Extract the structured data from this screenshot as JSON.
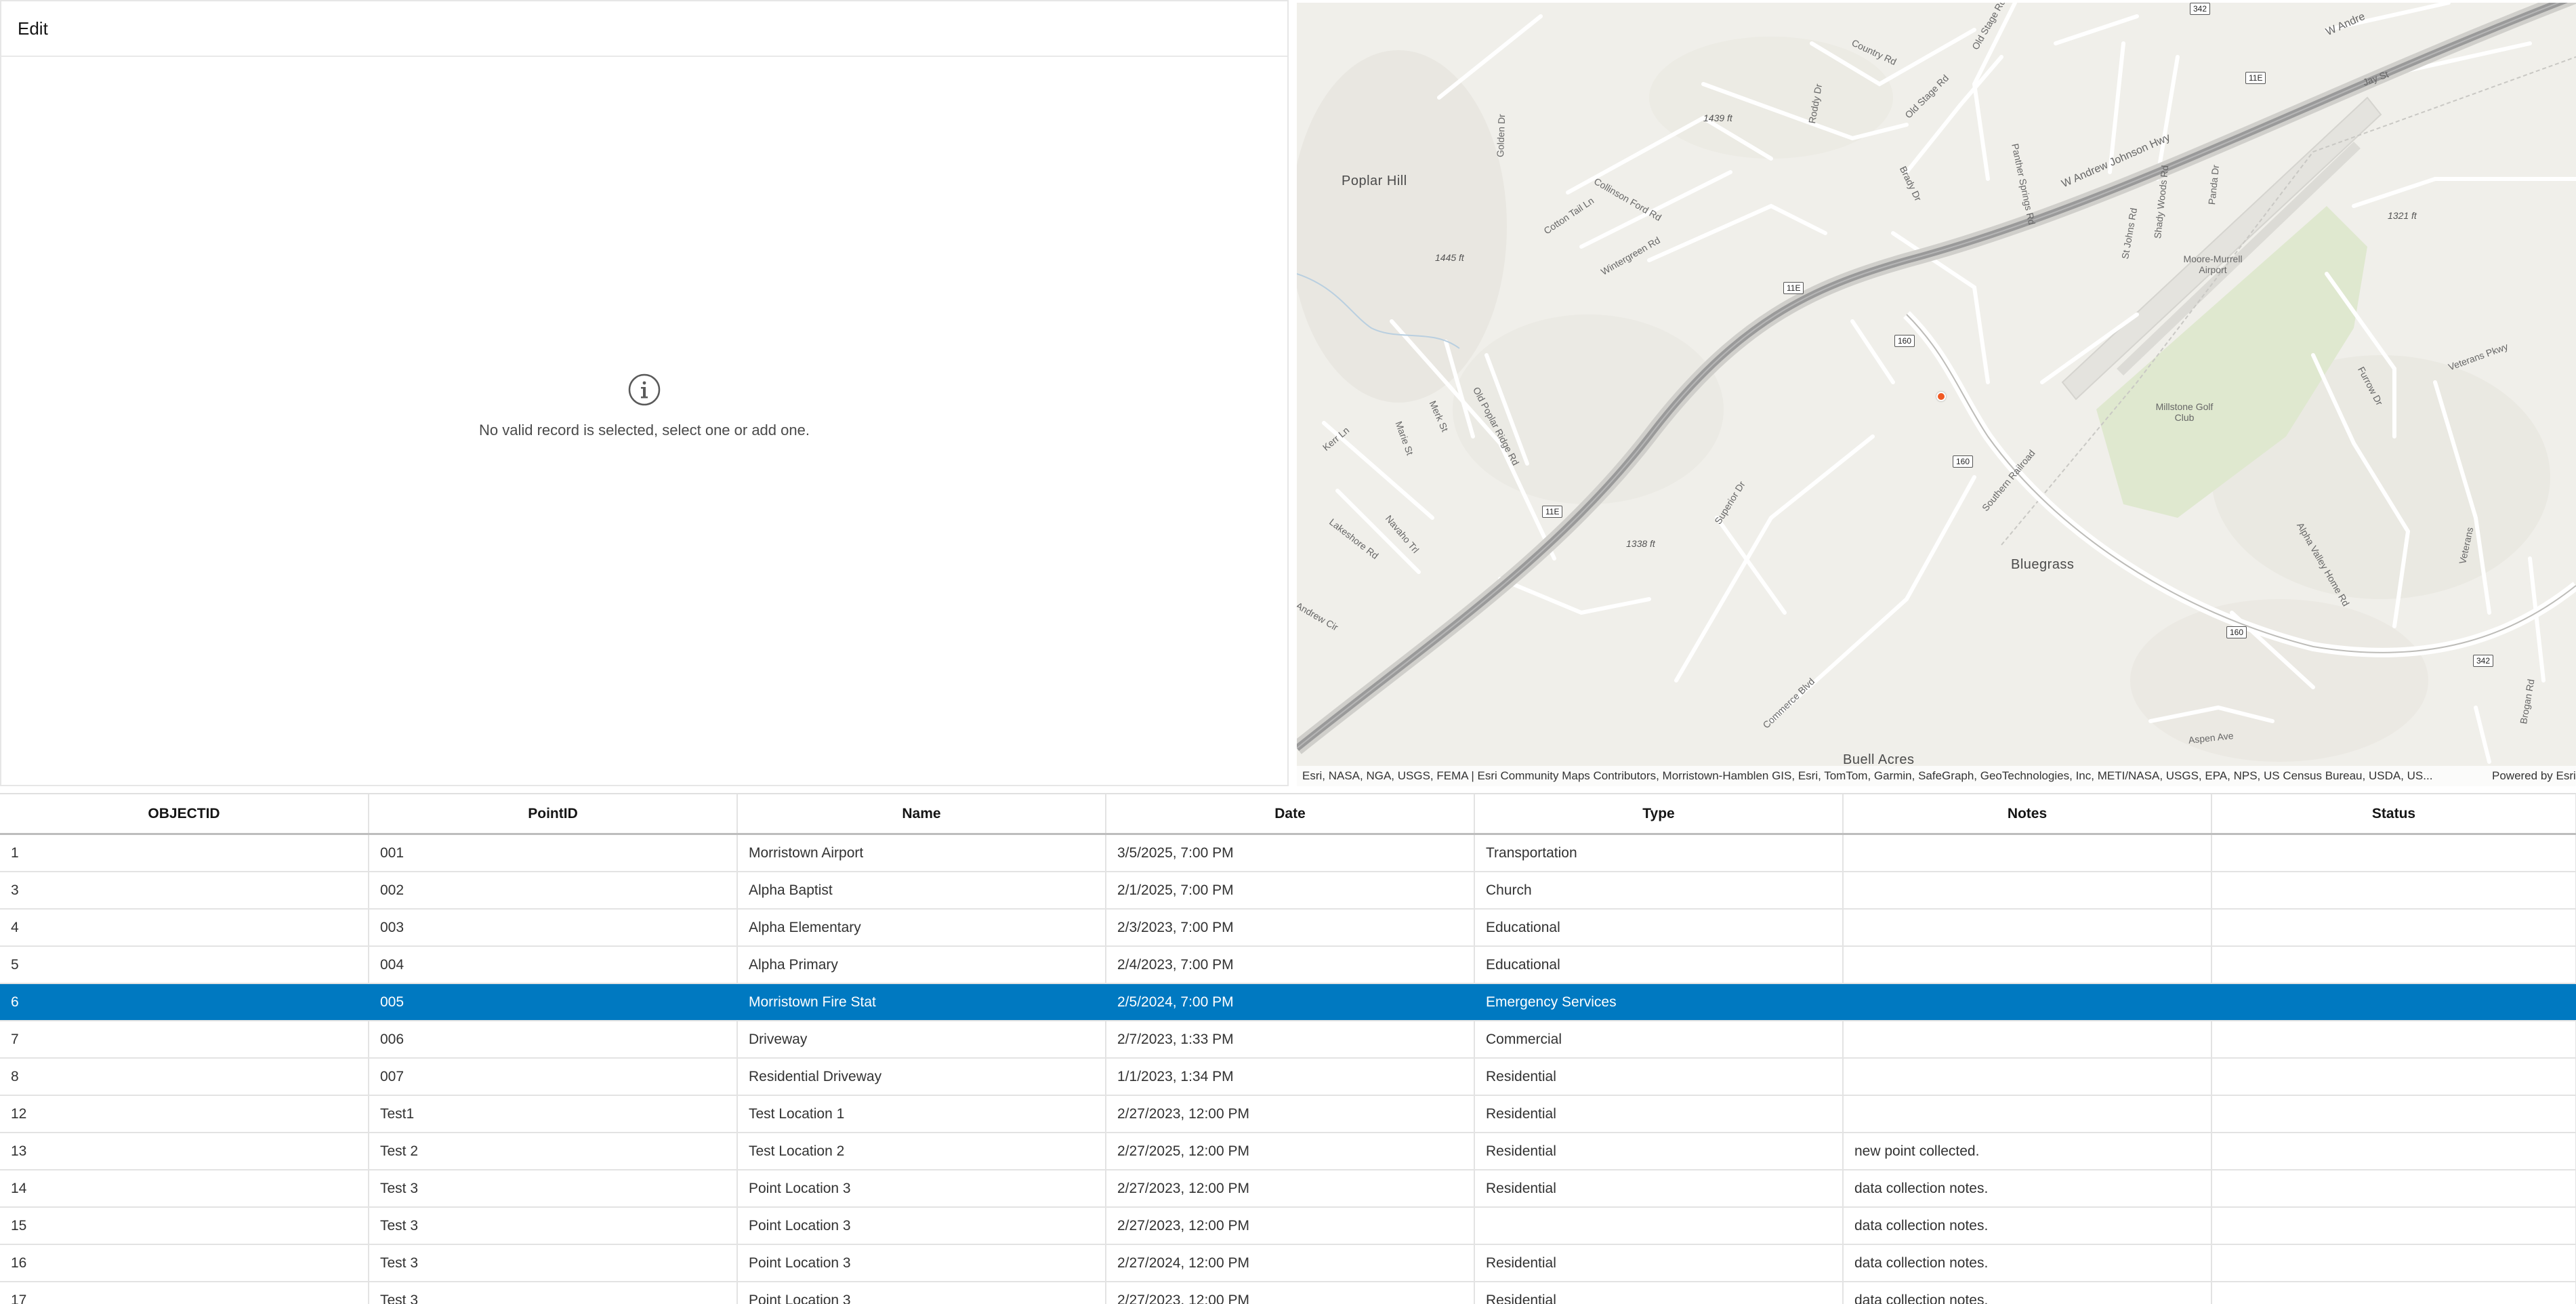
{
  "edit": {
    "title": "Edit",
    "empty_message": "No valid record is selected, select one or add one.",
    "info_icon": "info-circle-icon"
  },
  "map": {
    "places": [
      "Poplar Hill",
      "Bluegrass",
      "Buell Acres",
      "Moore-Murrell Airport",
      "Millstone Golf Club"
    ],
    "elevations": [
      "1439 ft",
      "1445 ft",
      "1338 ft",
      "1321 ft"
    ],
    "roads": [
      "W Andrew Johnson Hwy",
      "W Andre",
      "Country Rd",
      "Old Stage Rd",
      "Jay St",
      "Old Stage Rd",
      "Panther Springs Rd",
      "Collinson Ford Rd",
      "Cotton Tail Ln",
      "Wintergreen Rd",
      "Golden Dr",
      "Roddy Dr",
      "Brady Dr",
      "Old Poplar Ridge Rd",
      "Merk St",
      "Marie St",
      "Navaho Trl",
      "Kerr Ln",
      "Lakeshore Rd",
      "Superior Dr",
      "Commerce Blvd",
      "Southern Railroad",
      "Alpha Valley Home Rd",
      "Veterans Pkwy",
      "Furrow Dr",
      "St Johns Rd",
      "Shady Woods Rd",
      "Panda Dr",
      "Aspen Ave",
      "Brogan Rd",
      "Andrew Cir",
      "Veterans"
    ],
    "shields": [
      "11E",
      "11E",
      "11E",
      "160",
      "160",
      "160",
      "342",
      "342"
    ],
    "attribution": "Esri, NASA, NGA, USGS, FEMA | Esri Community Maps Contributors, Morristown-Hamblen GIS, Esri, TomTom, Garmin, SafeGraph, GeoTechnologies, Inc, METI/NASA, USGS, EPA, NPS, US Census Bureau, USDA, US...",
    "powered_by": "Powered by Esri",
    "colors": {
      "background": "#f0efea",
      "road": "#ffffff",
      "highway": "#9a9a9a",
      "green": "#dfe8cf",
      "marker": "#f05a24"
    }
  },
  "table": {
    "columns": [
      "OBJECTID",
      "PointID",
      "Name",
      "Date",
      "Type",
      "Notes",
      "Status"
    ],
    "selected_color": "#0079c1",
    "rows": [
      {
        "objectid": "1",
        "pointid": "001",
        "name": "Morristown Airport",
        "date": "3/5/2025, 7:00 PM",
        "type": "Transportation",
        "notes": "",
        "status": "",
        "selected": false
      },
      {
        "objectid": "3",
        "pointid": "002",
        "name": "Alpha Baptist",
        "date": "2/1/2025, 7:00 PM",
        "type": "Church",
        "notes": "",
        "status": "",
        "selected": false
      },
      {
        "objectid": "4",
        "pointid": "003",
        "name": "Alpha Elementary",
        "date": "2/3/2023, 7:00 PM",
        "type": "Educational",
        "notes": "",
        "status": "",
        "selected": false
      },
      {
        "objectid": "5",
        "pointid": "004",
        "name": "Alpha Primary",
        "date": "2/4/2023, 7:00 PM",
        "type": "Educational",
        "notes": "",
        "status": "",
        "selected": false
      },
      {
        "objectid": "6",
        "pointid": "005",
        "name": "Morristown Fire Stat",
        "date": "2/5/2024, 7:00 PM",
        "type": "Emergency Services",
        "notes": "",
        "status": "",
        "selected": true
      },
      {
        "objectid": "7",
        "pointid": "006",
        "name": "Driveway",
        "date": "2/7/2023, 1:33 PM",
        "type": "Commercial",
        "notes": "",
        "status": "",
        "selected": false
      },
      {
        "objectid": "8",
        "pointid": "007",
        "name": "Residential Driveway",
        "date": "1/1/2023, 1:34 PM",
        "type": "Residential",
        "notes": "",
        "status": "",
        "selected": false
      },
      {
        "objectid": "12",
        "pointid": "Test1",
        "name": "Test Location 1",
        "date": "2/27/2023, 12:00 PM",
        "type": "Residential",
        "notes": "",
        "status": "",
        "selected": false
      },
      {
        "objectid": "13",
        "pointid": "Test 2",
        "name": "Test Location 2",
        "date": "2/27/2025, 12:00 PM",
        "type": "Residential",
        "notes": "new point collected.",
        "status": "",
        "selected": false
      },
      {
        "objectid": "14",
        "pointid": "Test 3",
        "name": "Point Location 3",
        "date": "2/27/2023, 12:00 PM",
        "type": "Residential",
        "notes": "data collection notes.",
        "status": "",
        "selected": false
      },
      {
        "objectid": "15",
        "pointid": "Test 3",
        "name": "Point Location 3",
        "date": "2/27/2023, 12:00 PM",
        "type": "",
        "notes": "data collection notes.",
        "status": "",
        "selected": false
      },
      {
        "objectid": "16",
        "pointid": "Test 3",
        "name": "Point Location 3",
        "date": "2/27/2024, 12:00 PM",
        "type": "Residential",
        "notes": "data collection notes.",
        "status": "",
        "selected": false
      },
      {
        "objectid": "17",
        "pointid": "Test 3",
        "name": "Point Location 3",
        "date": "2/27/2023, 12:00 PM",
        "type": "Residential",
        "notes": "data collection notes.",
        "status": "",
        "selected": false
      }
    ]
  }
}
